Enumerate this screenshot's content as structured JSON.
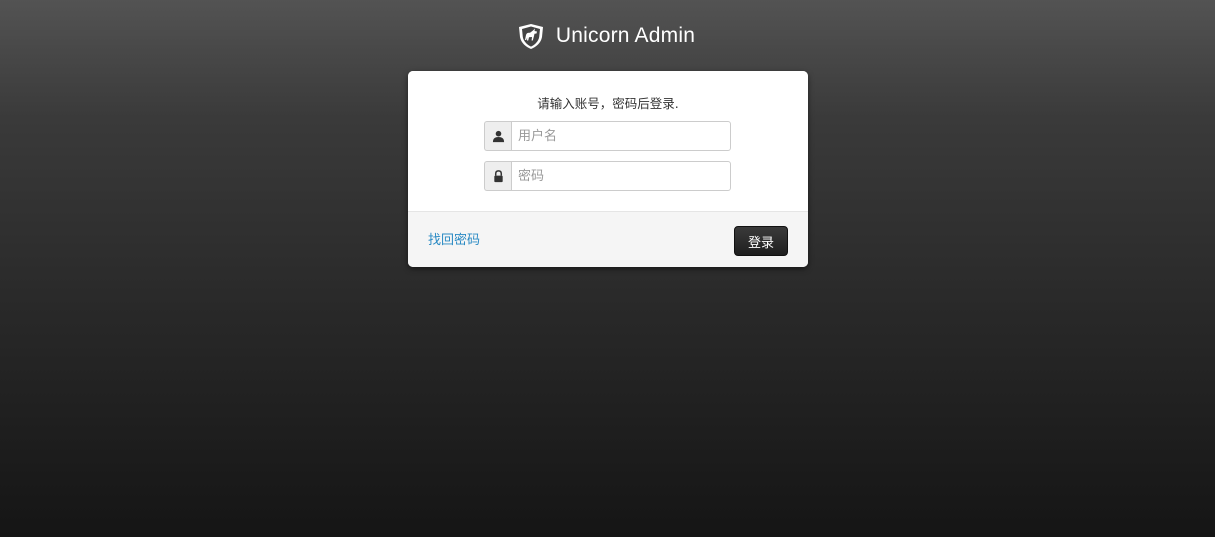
{
  "brand": {
    "title": "Unicorn Admin",
    "logo_icon": "unicorn-shield-icon"
  },
  "login": {
    "message": "请输入账号，密码后登录.",
    "username": {
      "icon": "user-icon",
      "placeholder": "用户名",
      "value": ""
    },
    "password": {
      "icon": "lock-icon",
      "placeholder": "密码",
      "value": ""
    },
    "recover_label": "找回密码",
    "submit_label": "登录"
  },
  "colors": {
    "link": "#2a8ac4",
    "button_bg": "#2a2a2a"
  }
}
